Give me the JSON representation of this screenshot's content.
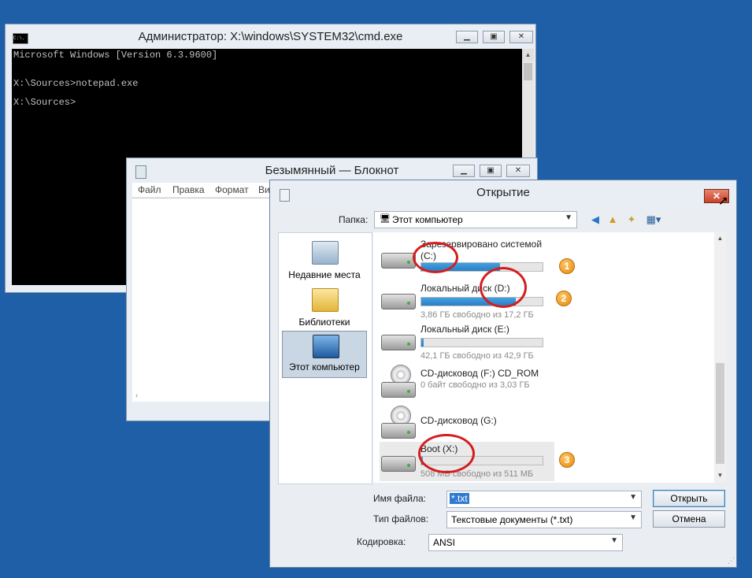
{
  "cmd": {
    "title": "Администратор: X:\\windows\\SYSTEM32\\cmd.exe",
    "icon_text": "C:\\.",
    "lines": [
      "Microsoft Windows [Version 6.3.9600]",
      "X:\\Sources>notepad.exe",
      "X:\\Sources>"
    ]
  },
  "notepad": {
    "title": "Безымянный — Блокнот",
    "menu": [
      "Файл",
      "Правка",
      "Формат",
      "Ви"
    ]
  },
  "dialog": {
    "title": "Открытие",
    "folder_label": "Папка:",
    "folder_value": "Этот компьютер",
    "places": [
      "Недавние места",
      "Библиотеки",
      "Этот компьютер"
    ],
    "drives": [
      {
        "name": "Зарезервировано системой (C:)",
        "name_line1": "Зарезервировано системой",
        "name_line2": "(C:)",
        "free": "",
        "used": 0.65
      },
      {
        "name": "Локальный диск (D:)",
        "free": "3,86 ГБ свободно из 17,2 ГБ",
        "used": 0.78
      },
      {
        "name": "Локальный диск (E:)",
        "free": "42,1 ГБ свободно из 42,9 ГБ",
        "used": 0.02
      },
      {
        "name": "CD-дисковод (F:) CD_ROM",
        "free": "0 байт свободно из 3,03 ГБ"
      },
      {
        "name": "CD-дисковод (G:)",
        "free": ""
      },
      {
        "name": "Boot (X:)",
        "free": "508 МБ свободно из 511 МБ",
        "used": 0.01
      }
    ],
    "markers": [
      "1",
      "2",
      "3"
    ],
    "filename_label": "Имя файла:",
    "filename_value": "*.txt",
    "filetype_label": "Тип файлов:",
    "filetype_value": "Текстовые документы (*.txt)",
    "encoding_label": "Кодировка:",
    "encoding_value": "ANSI",
    "open_button": "Открыть",
    "cancel_button": "Отмена"
  }
}
